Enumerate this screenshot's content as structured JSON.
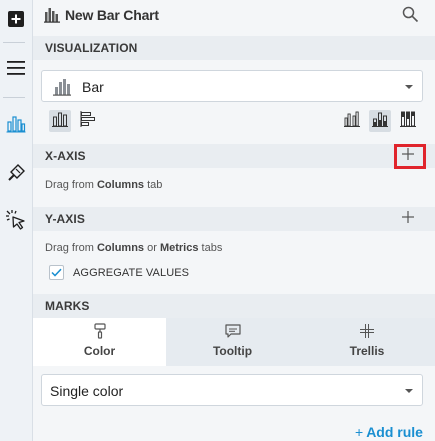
{
  "rail": {
    "items": [
      {
        "name": "add-panel",
        "icon": "plus-square-icon"
      },
      {
        "name": "layers",
        "icon": "hamburger-menu-icon"
      },
      {
        "name": "visualization",
        "icon": "bar-chart-icon",
        "active": true
      },
      {
        "name": "format",
        "icon": "paintbrush-icon"
      },
      {
        "name": "interactions",
        "icon": "pointer-click-icon"
      }
    ]
  },
  "header": {
    "title": "New Bar Chart",
    "icon": "bar-chart-icon",
    "search_icon": "search-icon"
  },
  "visualization": {
    "label": "VISUALIZATION",
    "selected_type": "Bar",
    "orientation_options": [
      "vertical-bars",
      "horizontal-bars"
    ],
    "orientation_selected": "vertical-bars",
    "stack_options": [
      "clustered",
      "stacked",
      "percent-stacked"
    ],
    "stack_selected": "stacked"
  },
  "x_axis": {
    "label": "X-AXIS",
    "hint_prefix": "Drag from ",
    "hint_bold_1": "Columns",
    "hint_suffix": " tab"
  },
  "y_axis": {
    "label": "Y-AXIS",
    "hint_prefix": "Drag from ",
    "hint_bold_1": "Columns",
    "hint_middle": " or ",
    "hint_bold_2": "Metrics",
    "hint_suffix": " tabs",
    "aggregate_label": "AGGREGATE VALUES",
    "aggregate_checked": true
  },
  "marks": {
    "label": "MARKS",
    "tabs": [
      {
        "label": "Color",
        "icon": "paint-roller-icon",
        "active": true
      },
      {
        "label": "Tooltip",
        "icon": "speech-bubble-icon",
        "active": false
      },
      {
        "label": "Trellis",
        "icon": "trellis-icon",
        "active": false
      }
    ],
    "color_mode": "Single color",
    "add_rule": "Add rule",
    "add_rule_plus": "+"
  },
  "colors": {
    "accent_blue": "#1a8fd1",
    "highlight_red": "#e0242c"
  }
}
